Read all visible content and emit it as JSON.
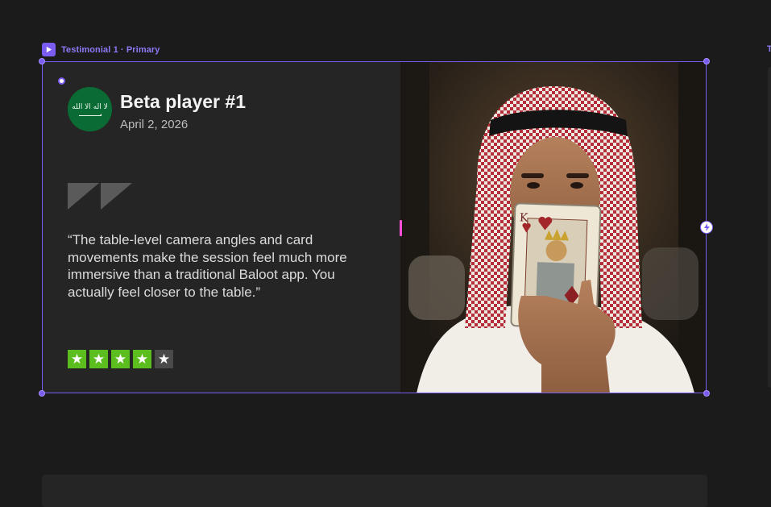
{
  "frame": {
    "label": "Testimonial 1 · Primary",
    "next_label": "T",
    "icon": "play-icon",
    "accent": "#7b5cf0"
  },
  "testimonial": {
    "name": "Beta player #1",
    "date": "April 2, 2026",
    "avatar": "saudi-flag-icon",
    "quote": "“The table-level camera angles and card movements make the session feel much more immersive than a traditional Baloot app. You actually feel closer to the table.”",
    "rating": 4,
    "rating_max": 5,
    "star_color": "#5cbd1f",
    "star_empty_color": "#4a4a4a"
  },
  "photo": {
    "icon": "man-holding-king-card-image"
  }
}
